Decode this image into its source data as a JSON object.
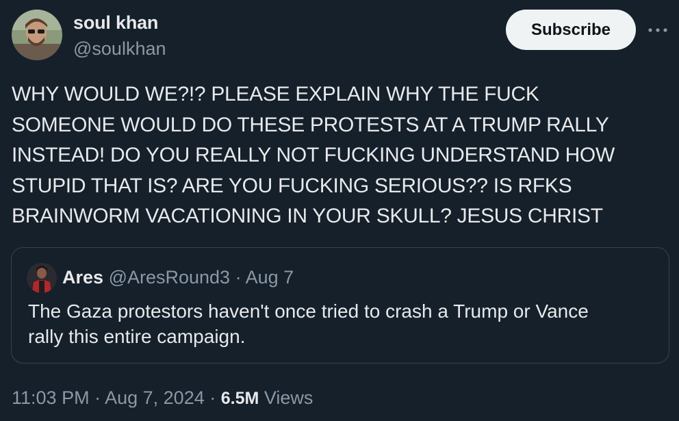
{
  "author": {
    "name": "soul khan",
    "handle": "@soulkhan"
  },
  "actions": {
    "subscribe_label": "Subscribe",
    "more_icon": "more-horizontal-icon"
  },
  "tweet": {
    "lines": [
      "WHY WOULD WE?!? PLEASE EXPLAIN WHY THE FUCK",
      "SOMEONE WOULD DO THESE PROTESTS AT A TRUMP RALLY",
      "INSTEAD! DO YOU REALLY NOT FUCKING UNDERSTAND HOW",
      "STUPID THAT IS? ARE YOU FUCKING SERIOUS?? IS RFKS",
      "BRAINWORM VACATIONING IN YOUR SKULL? JESUS CHRIST"
    ]
  },
  "quote": {
    "name": "Ares",
    "handle": "@AresRound3",
    "date": "Aug 7",
    "lines": [
      "The Gaza protestors haven't once tried to crash a Trump or Vance",
      "rally this entire campaign."
    ]
  },
  "footer": {
    "time": "11:03 PM",
    "date": "Aug 7, 2024",
    "views_count": "6.5M",
    "views_label": "Views"
  },
  "colors": {
    "background": "#15202b",
    "text": "#e7e9ea",
    "muted": "#8b98a5",
    "border": "#38444d",
    "button_bg": "#eff3f4"
  }
}
